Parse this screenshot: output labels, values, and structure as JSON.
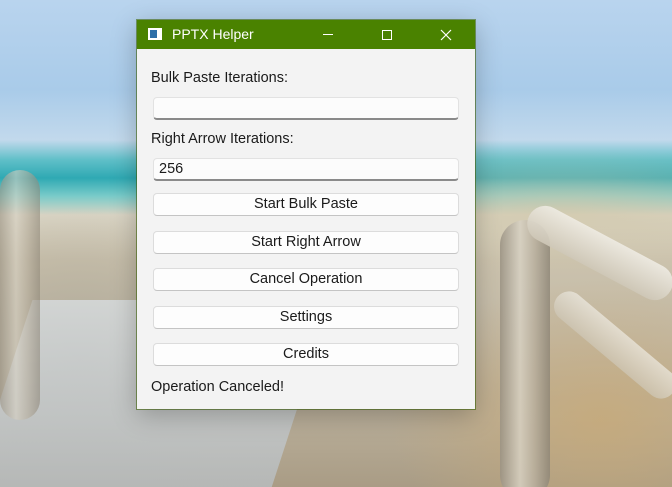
{
  "window": {
    "title": "PPTX Helper",
    "title_bar_color": "#4a8200"
  },
  "icons": {
    "app": "app-window-icon",
    "minimize": "minimize-icon",
    "maximize": "maximize-icon",
    "close": "close-icon"
  },
  "form": {
    "bulk_paste": {
      "label": "Bulk Paste Iterations:",
      "value": ""
    },
    "right_arrow": {
      "label": "Right Arrow Iterations:",
      "value": "256"
    }
  },
  "buttons": {
    "start_bulk_paste": "Start Bulk Paste",
    "start_right_arrow": "Start Right Arrow",
    "cancel_operation": "Cancel Operation",
    "settings": "Settings",
    "credits": "Credits"
  },
  "status": {
    "text": "Operation Canceled!"
  }
}
